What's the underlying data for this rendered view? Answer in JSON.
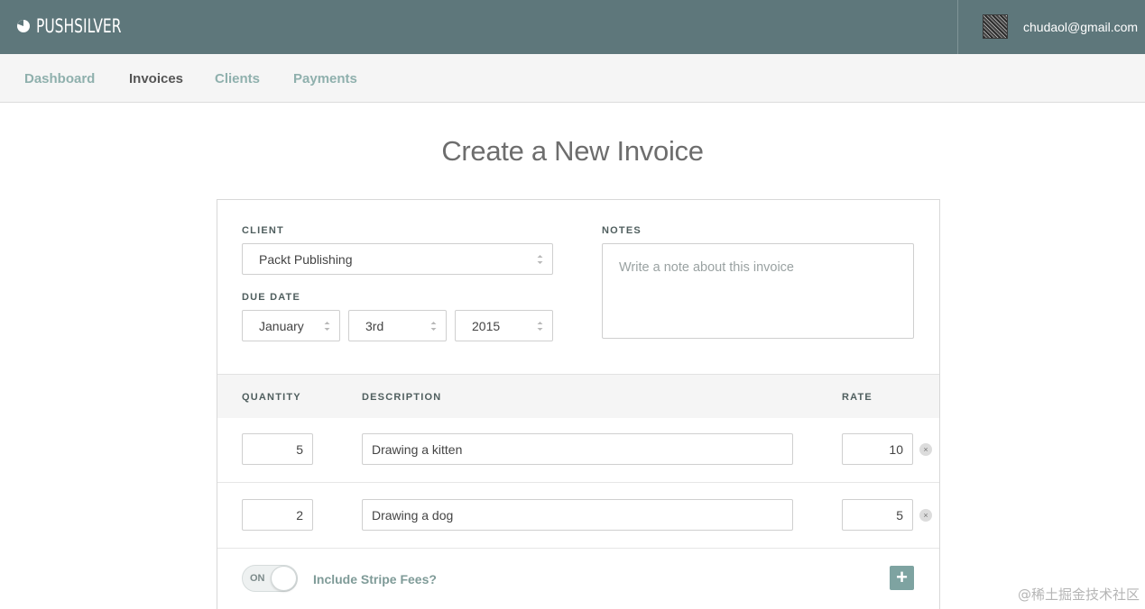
{
  "brand": {
    "name": "PUSHSILVER",
    "icon": "pie-logo-icon"
  },
  "user": {
    "email": "chudaol@gmail.com"
  },
  "nav": {
    "items": [
      {
        "label": "Dashboard",
        "active": false
      },
      {
        "label": "Invoices",
        "active": true
      },
      {
        "label": "Clients",
        "active": false
      },
      {
        "label": "Payments",
        "active": false
      }
    ]
  },
  "page": {
    "title": "Create a New Invoice"
  },
  "form": {
    "client_label": "CLIENT",
    "client_value": "Packt Publishing",
    "due_date_label": "DUE DATE",
    "due_month": "January",
    "due_day": "3rd",
    "due_year": "2015",
    "notes_label": "NOTES",
    "notes_placeholder": "Write a note about this invoice"
  },
  "items": {
    "headers": {
      "quantity": "QUANTITY",
      "description": "DESCRIPTION",
      "rate": "RATE"
    },
    "rows": [
      {
        "quantity": "5",
        "description": "Drawing a kitten",
        "rate": "10"
      },
      {
        "quantity": "2",
        "description": "Drawing a dog",
        "rate": "5"
      }
    ]
  },
  "stripe": {
    "toggle_state": "ON",
    "label": "Include Stripe Fees?"
  },
  "add_button": "+",
  "remove_glyph": "×",
  "watermark": "@稀土掘金技术社区",
  "colors": {
    "topbar": "#5e777b",
    "accent": "#8fb0ad",
    "add_button": "#7ea3a1"
  }
}
